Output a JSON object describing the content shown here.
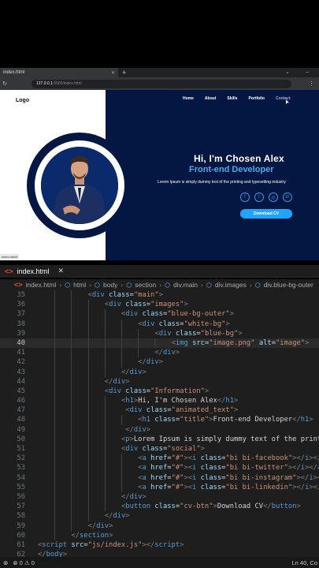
{
  "browser": {
    "tab_title": "index.html",
    "url_host": "127.0.0.1",
    "url_path": ":5500/index.html"
  },
  "site": {
    "logo": "Logo",
    "nav": [
      "Home",
      "About",
      "Skills",
      "Portfolio",
      "Contact"
    ],
    "greeting": "Hi, I'm Chosen Alex",
    "role": "Front-end Developer",
    "lorem": "Lorem Ipsum is simply dummy text of the printing and typesetting industry",
    "socials": [
      "facebook-icon",
      "twitter-icon",
      "instagram-icon",
      "linkedin-icon"
    ],
    "cv_button": "Download CV",
    "status_chip": "index.html#"
  },
  "editor": {
    "tab_label": "index.html",
    "breadcrumbs": [
      "index.html",
      "html",
      "body",
      "section",
      "div.main",
      "div.images",
      "div.blue-bg-outer"
    ],
    "active_line": 40,
    "lines": [
      {
        "n": "35",
        "indent": 3,
        "tokens": [
          [
            "p",
            "<"
          ],
          [
            "t",
            "div"
          ],
          [
            "d",
            " "
          ],
          [
            "a",
            "class"
          ],
          [
            "d",
            "="
          ],
          [
            "s",
            "\"main\""
          ],
          [
            "p",
            ">"
          ]
        ]
      },
      {
        "n": "36",
        "indent": 4,
        "tokens": [
          [
            "p",
            "<"
          ],
          [
            "t",
            "div"
          ],
          [
            "d",
            " "
          ],
          [
            "a",
            "class"
          ],
          [
            "d",
            "="
          ],
          [
            "s",
            "\"images\""
          ],
          [
            "p",
            ">"
          ]
        ]
      },
      {
        "n": "37",
        "indent": 5,
        "tokens": [
          [
            "p",
            "<"
          ],
          [
            "t",
            "div"
          ],
          [
            "d",
            " "
          ],
          [
            "a",
            "class"
          ],
          [
            "d",
            "="
          ],
          [
            "s",
            "\"blue-bg-outer\""
          ],
          [
            "p",
            ">"
          ]
        ]
      },
      {
        "n": "38",
        "indent": 6,
        "tokens": [
          [
            "p",
            "<"
          ],
          [
            "t",
            "div"
          ],
          [
            "d",
            " "
          ],
          [
            "a",
            "class"
          ],
          [
            "d",
            "="
          ],
          [
            "s",
            "\"white-bg\""
          ],
          [
            "p",
            ">"
          ]
        ]
      },
      {
        "n": "39",
        "indent": 7,
        "tokens": [
          [
            "p",
            "<"
          ],
          [
            "t",
            "div"
          ],
          [
            "d",
            " "
          ],
          [
            "a",
            "class"
          ],
          [
            "d",
            "="
          ],
          [
            "s",
            "\"blue-bg\""
          ],
          [
            "p",
            ">"
          ]
        ]
      },
      {
        "n": "40",
        "indent": 8,
        "tokens": [
          [
            "p",
            "<"
          ],
          [
            "t",
            "img"
          ],
          [
            "d",
            " "
          ],
          [
            "a",
            "src"
          ],
          [
            "d",
            "="
          ],
          [
            "s",
            "\"image.png\""
          ],
          [
            "d",
            " "
          ],
          [
            "a",
            "alt"
          ],
          [
            "d",
            "="
          ],
          [
            "s",
            "\"image\""
          ],
          [
            "p",
            ">"
          ]
        ]
      },
      {
        "n": "41",
        "indent": 7,
        "tokens": [
          [
            "p",
            "</"
          ],
          [
            "t",
            "div"
          ],
          [
            "p",
            ">"
          ]
        ]
      },
      {
        "n": "42",
        "indent": 6,
        "tokens": [
          [
            "p",
            "</"
          ],
          [
            "t",
            "div"
          ],
          [
            "p",
            ">"
          ]
        ]
      },
      {
        "n": "43",
        "indent": 5,
        "tokens": [
          [
            "p",
            "</"
          ],
          [
            "t",
            "div"
          ],
          [
            "p",
            ">"
          ]
        ]
      },
      {
        "n": "44",
        "indent": 4,
        "tokens": [
          [
            "p",
            "</"
          ],
          [
            "t",
            "div"
          ],
          [
            "p",
            ">"
          ]
        ]
      },
      {
        "n": "45",
        "indent": 4,
        "tokens": [
          [
            "p",
            "<"
          ],
          [
            "t",
            "div"
          ],
          [
            "d",
            " "
          ],
          [
            "a",
            "class"
          ],
          [
            "d",
            "="
          ],
          [
            "s",
            "\"Information\""
          ],
          [
            "p",
            ">"
          ]
        ]
      },
      {
        "n": "46",
        "indent": 5,
        "tokens": [
          [
            "p",
            "<"
          ],
          [
            "t",
            "h1"
          ],
          [
            "p",
            ">"
          ],
          [
            "d",
            "Hi, I'm Chosen Alex"
          ],
          [
            "p",
            "</"
          ],
          [
            "t",
            "h1"
          ],
          [
            "p",
            ">"
          ]
        ]
      },
      {
        "n": "47",
        "indent": 5,
        "tokens": [
          [
            "d",
            " "
          ],
          [
            "p",
            "<"
          ],
          [
            "t",
            "div"
          ],
          [
            "d",
            " "
          ],
          [
            "a",
            "class"
          ],
          [
            "d",
            "="
          ],
          [
            "s",
            "\"animated_text\""
          ],
          [
            "p",
            ">"
          ]
        ]
      },
      {
        "n": "48",
        "indent": 6,
        "tokens": [
          [
            "p",
            "<"
          ],
          [
            "t",
            "h1"
          ],
          [
            "d",
            " "
          ],
          [
            "a",
            "class"
          ],
          [
            "d",
            "="
          ],
          [
            "s",
            "\"title\""
          ],
          [
            "p",
            ">"
          ],
          [
            "d",
            "Front-end Developer"
          ],
          [
            "p",
            "</"
          ],
          [
            "t",
            "h1"
          ],
          [
            "p",
            ">"
          ]
        ]
      },
      {
        "n": "49",
        "indent": 5,
        "tokens": [
          [
            "d",
            " "
          ],
          [
            "p",
            "</"
          ],
          [
            "t",
            "div"
          ],
          [
            "p",
            ">"
          ]
        ]
      },
      {
        "n": "50",
        "indent": 5,
        "tokens": [
          [
            "p",
            "<"
          ],
          [
            "t",
            "p"
          ],
          [
            "p",
            ">"
          ],
          [
            "d",
            "Lorem Ipsum is simply dummy text of the printing and"
          ]
        ]
      },
      {
        "n": "51",
        "indent": 5,
        "tokens": [
          [
            "p",
            "<"
          ],
          [
            "t",
            "div"
          ],
          [
            "d",
            " "
          ],
          [
            "a",
            "class"
          ],
          [
            "d",
            "="
          ],
          [
            "s",
            "\"social\""
          ],
          [
            "p",
            ">"
          ]
        ]
      },
      {
        "n": "52",
        "indent": 6,
        "tokens": [
          [
            "p",
            "<"
          ],
          [
            "t",
            "a"
          ],
          [
            "d",
            " "
          ],
          [
            "a",
            "href"
          ],
          [
            "d",
            "="
          ],
          [
            "s",
            "\"#\""
          ],
          [
            "p",
            "><"
          ],
          [
            "t",
            "i"
          ],
          [
            "d",
            " "
          ],
          [
            "a",
            "class"
          ],
          [
            "d",
            "="
          ],
          [
            "s",
            "\"bi bi-facebook\""
          ],
          [
            "p",
            "></"
          ],
          [
            "t",
            "i"
          ],
          [
            "p",
            "></"
          ],
          [
            "t",
            "a"
          ],
          [
            "p",
            ">"
          ]
        ]
      },
      {
        "n": "53",
        "indent": 6,
        "tokens": [
          [
            "p",
            "<"
          ],
          [
            "t",
            "a"
          ],
          [
            "d",
            " "
          ],
          [
            "a",
            "href"
          ],
          [
            "d",
            "="
          ],
          [
            "s",
            "\"#\""
          ],
          [
            "p",
            "><"
          ],
          [
            "t",
            "i"
          ],
          [
            "d",
            " "
          ],
          [
            "a",
            "class"
          ],
          [
            "d",
            "="
          ],
          [
            "s",
            "\"bi bi-twitter\""
          ],
          [
            "p",
            "></"
          ],
          [
            "t",
            "i"
          ],
          [
            "p",
            "></"
          ],
          [
            "t",
            "a"
          ],
          [
            "p",
            ">"
          ]
        ]
      },
      {
        "n": "54",
        "indent": 6,
        "tokens": [
          [
            "p",
            "<"
          ],
          [
            "t",
            "a"
          ],
          [
            "d",
            " "
          ],
          [
            "a",
            "href"
          ],
          [
            "d",
            "="
          ],
          [
            "s",
            "\"#\""
          ],
          [
            "p",
            "><"
          ],
          [
            "t",
            "i"
          ],
          [
            "d",
            " "
          ],
          [
            "a",
            "class"
          ],
          [
            "d",
            "="
          ],
          [
            "s",
            "\"bi bi-instagram\""
          ],
          [
            "p",
            "></"
          ],
          [
            "t",
            "i"
          ],
          [
            "p",
            "></"
          ],
          [
            "t",
            "a"
          ],
          [
            "p",
            ">"
          ]
        ]
      },
      {
        "n": "55",
        "indent": 6,
        "tokens": [
          [
            "p",
            "<"
          ],
          [
            "t",
            "a"
          ],
          [
            "d",
            " "
          ],
          [
            "a",
            "href"
          ],
          [
            "d",
            "="
          ],
          [
            "s",
            "\"#\""
          ],
          [
            "p",
            "><"
          ],
          [
            "t",
            "i"
          ],
          [
            "d",
            " "
          ],
          [
            "a",
            "class"
          ],
          [
            "d",
            "="
          ],
          [
            "s",
            "\"bi bi-linkedin\""
          ],
          [
            "p",
            "></"
          ],
          [
            "t",
            "i"
          ],
          [
            "p",
            "></"
          ],
          [
            "t",
            "a"
          ],
          [
            "p",
            ">"
          ]
        ]
      },
      {
        "n": "56",
        "indent": 5,
        "tokens": [
          [
            "p",
            "</"
          ],
          [
            "t",
            "div"
          ],
          [
            "p",
            ">"
          ]
        ]
      },
      {
        "n": "57",
        "indent": 5,
        "tokens": [
          [
            "p",
            "<"
          ],
          [
            "t",
            "button"
          ],
          [
            "d",
            " "
          ],
          [
            "a",
            "class"
          ],
          [
            "d",
            "="
          ],
          [
            "s",
            "\"cv-btn\""
          ],
          [
            "p",
            ">"
          ],
          [
            "d",
            "Download CV"
          ],
          [
            "p",
            "</"
          ],
          [
            "t",
            "button"
          ],
          [
            "p",
            ">"
          ]
        ]
      },
      {
        "n": "58",
        "indent": 4,
        "tokens": [
          [
            "p",
            "</"
          ],
          [
            "t",
            "div"
          ],
          [
            "p",
            ">"
          ]
        ]
      },
      {
        "n": "59",
        "indent": 3,
        "tokens": [
          [
            "p",
            "</"
          ],
          [
            "t",
            "div"
          ],
          [
            "p",
            ">"
          ]
        ]
      },
      {
        "n": "60",
        "indent": 2,
        "tokens": [
          [
            "p",
            "</"
          ],
          [
            "t",
            "section"
          ],
          [
            "p",
            ">"
          ]
        ]
      },
      {
        "n": "61",
        "indent": 0,
        "tokens": [
          [
            "p",
            "<"
          ],
          [
            "t",
            "script"
          ],
          [
            "d",
            " "
          ],
          [
            "a",
            "src"
          ],
          [
            "d",
            "="
          ],
          [
            "s",
            "\"js/index.js\""
          ],
          [
            "p",
            "></"
          ],
          [
            "t",
            "script"
          ],
          [
            "p",
            ">"
          ]
        ]
      },
      {
        "n": "62",
        "indent": 0,
        "tokens": [
          [
            "p",
            "</"
          ],
          [
            "t",
            "body"
          ],
          [
            "p",
            ">"
          ]
        ]
      }
    ]
  },
  "status": {
    "problems": "⊗ 0 ⚠ 0",
    "position": "Ln 40, Co"
  }
}
